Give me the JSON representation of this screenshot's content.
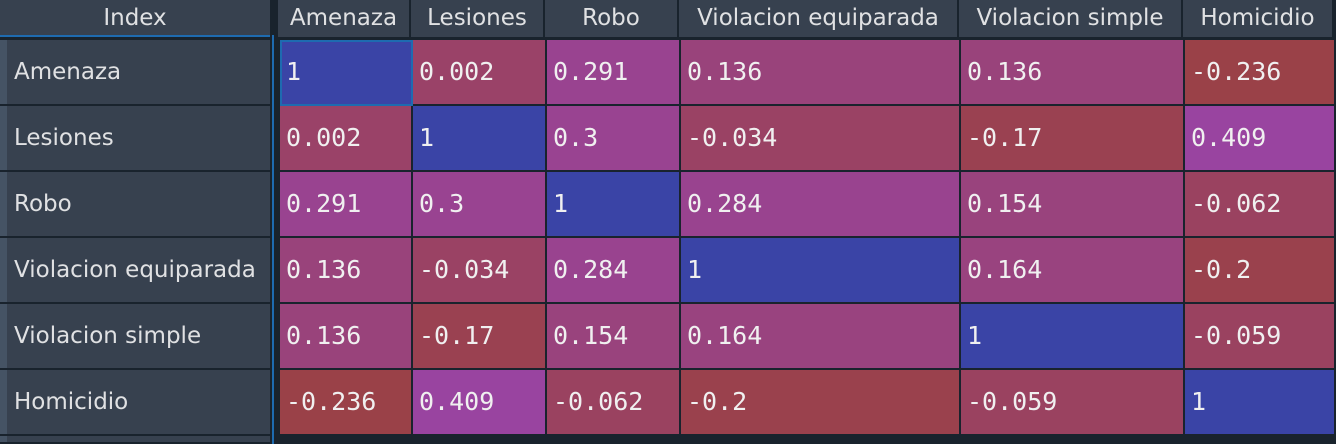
{
  "corner_label": "Index",
  "columns": [
    "Amenaza",
    "Lesiones",
    "Robo",
    "Violacion equiparada",
    "Violacion simple",
    "Homicidio"
  ],
  "rows": [
    {
      "label": "Amenaza",
      "values": [
        "1",
        "0.002",
        "0.291",
        "0.136",
        "0.136",
        "-0.236"
      ]
    },
    {
      "label": "Lesiones",
      "values": [
        "0.002",
        "1",
        "0.3",
        "-0.034",
        "-0.17",
        "0.409"
      ]
    },
    {
      "label": "Robo",
      "values": [
        "0.291",
        "0.3",
        "1",
        "0.284",
        "0.154",
        "-0.062"
      ]
    },
    {
      "label": "Violacion equiparada",
      "values": [
        "0.136",
        "-0.034",
        "0.284",
        "1",
        "0.164",
        "-0.2"
      ]
    },
    {
      "label": "Violacion simple",
      "values": [
        "0.136",
        "-0.17",
        "0.154",
        "0.164",
        "1",
        "-0.059"
      ]
    },
    {
      "label": "Homicidio",
      "values": [
        "-0.236",
        "0.409",
        "-0.062",
        "-0.2",
        "-0.059",
        "1"
      ]
    }
  ],
  "colors": {
    "diagonal": "#3a44a6",
    "low": "#9a4148",
    "high": "#9944a0",
    "header_bg": "#37414f",
    "text": "#e0e1e3"
  }
}
